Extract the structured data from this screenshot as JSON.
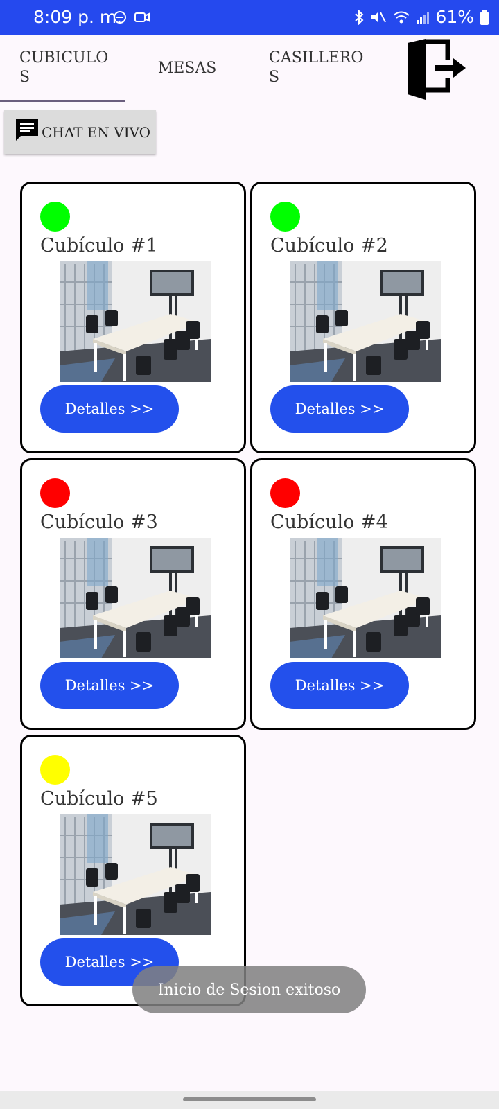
{
  "status_bar": {
    "time": "8:09 p. m.",
    "battery": "61%",
    "icons": [
      "do-not-disturb-icon",
      "video-icon",
      "bluetooth-icon",
      "mute-icon",
      "wifi-icon",
      "signal-icon",
      "battery-icon"
    ]
  },
  "tabs": [
    {
      "label": "CUBICULO\nS",
      "selected": true
    },
    {
      "label": "MESAS",
      "selected": false
    },
    {
      "label": "CASILLERO\nS",
      "selected": false
    }
  ],
  "logout_icon": "logout-door-icon",
  "chat_button": {
    "label": "CHAT EN VIVO",
    "icon": "chat-bubble-icon"
  },
  "cards": [
    {
      "title": "Cubículo #1",
      "status_color": "#00ff00",
      "button": "Detalles >>"
    },
    {
      "title": "Cubículo #2",
      "status_color": "#00ff00",
      "button": "Detalles >>"
    },
    {
      "title": "Cubículo #3",
      "status_color": "#ff0000",
      "button": "Detalles >>"
    },
    {
      "title": "Cubículo #4",
      "status_color": "#ff0000",
      "button": "Detalles >>"
    },
    {
      "title": "Cubículo #5",
      "status_color": "#ffff00",
      "button": "Detalles >>"
    }
  ],
  "toast": "Inicio de Sesion exitoso",
  "colors": {
    "accent": "#2350ec",
    "status_bar": "#2549ee",
    "background": "#fdf8fd"
  }
}
